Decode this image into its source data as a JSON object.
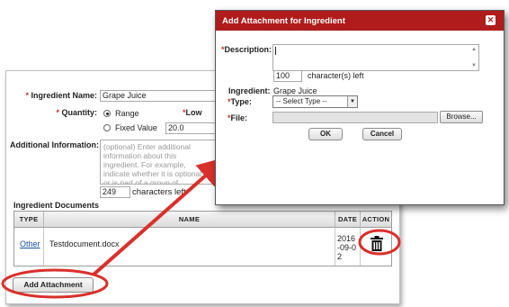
{
  "form": {
    "ingredient_name_label": "Ingredient Name:",
    "ingredient_name_value": "Grape Juice",
    "quantity_label": "Quantity:",
    "range_option": "Range",
    "low_label": "Low",
    "fixed_value_option": "Fixed Value",
    "fixed_value": "20.0",
    "additional_info_label": "Additional Information:",
    "additional_info_placeholder": "(optional) Enter additional information about this ingredient. For example, indicate whether it is optional, or is part of a group of ingredients, information, etc.",
    "chars_left_value": "249",
    "chars_left_label": "characters left",
    "required_mark": "*"
  },
  "documents": {
    "section_title": "Ingredient Documents",
    "headers": {
      "type": "Type",
      "name": "Name",
      "date": "Date",
      "action": "Action"
    },
    "rows": [
      {
        "type": "Other",
        "name": "Testdocument.docx",
        "date": "2016-09-02"
      }
    ],
    "delete_icon": "trash-icon",
    "add_button": "Add Attachment"
  },
  "modal": {
    "title": "Add Attachment for Ingredient",
    "close_icon": "close-icon",
    "description_label": "Description:",
    "description_value": "",
    "chars_left_value": "100",
    "chars_left_label": "character(s) left",
    "ingredient_label": "Ingredient:",
    "ingredient_value": "Grape Juice",
    "type_label": "Type:",
    "type_selected": "-- Select Type --",
    "file_label": "File:",
    "browse_button": "Browse...",
    "ok_button": "OK",
    "cancel_button": "Cancel"
  },
  "colors": {
    "modal_title_bg": "#b01c1c",
    "annotation_red": "#d9302b",
    "required_star": "#c0392b",
    "link": "#1a4fa0"
  }
}
